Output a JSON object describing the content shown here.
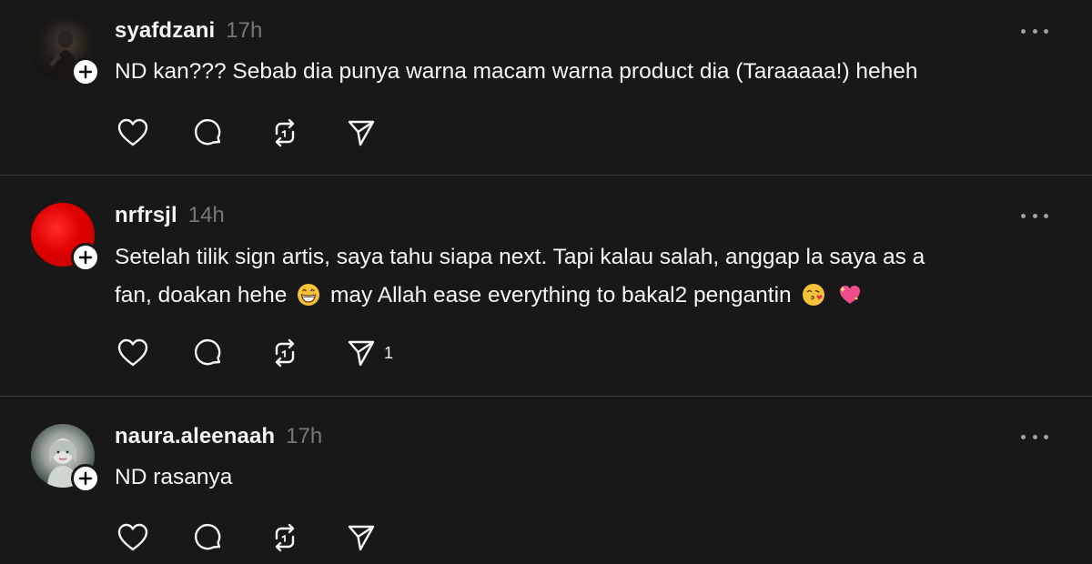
{
  "posts": [
    {
      "username": "syafdzani",
      "time": "17h",
      "text": "ND kan??? Sebab dia punya warna macam warna product dia (Taraaaaa!) heheh",
      "share_count": ""
    },
    {
      "username": "nrfrsjl",
      "time": "14h",
      "text_line1": "Setelah tilik sign artis, saya tahu siapa next. Tapi kalau salah, anggap la saya as a",
      "text_line2_a": "fan, doakan hehe",
      "text_line2_b": "may Allah ease everything to bakal2 pengantin",
      "emojis": [
        "grinning-face-emoji",
        "face-blowing-kiss-emoji",
        "sparkling-heart-emoji"
      ],
      "share_count": "1"
    },
    {
      "username": "naura.aleenaah",
      "time": "17h",
      "text": "ND rasanya",
      "share_count": ""
    }
  ],
  "icons": {
    "like": "heart-icon",
    "reply": "comment-icon",
    "repost": "repost-icon",
    "share": "send-icon",
    "more": "more-options-icon",
    "follow": "plus-icon"
  },
  "colors": {
    "background": "#181818",
    "text": "#f3f5f7",
    "muted": "#777777",
    "divider": "#3a3a3a"
  }
}
